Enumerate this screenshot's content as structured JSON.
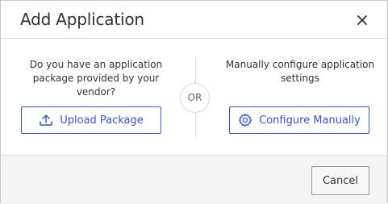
{
  "dialog": {
    "title": "Add Application",
    "close_icon": "close-icon"
  },
  "left": {
    "prompt": "Do you have an application package provided by your vendor?",
    "button_label": "Upload Package",
    "button_icon": "upload-icon"
  },
  "separator": {
    "label": "OR"
  },
  "right": {
    "prompt": "Manually configure application settings",
    "button_label": "Configure Manually",
    "button_icon": "gear-icon"
  },
  "footer": {
    "cancel_label": "Cancel"
  },
  "colors": {
    "accent": "#3456c0",
    "border": "#dcdcdc",
    "footer_bg": "#f4f4f4"
  }
}
